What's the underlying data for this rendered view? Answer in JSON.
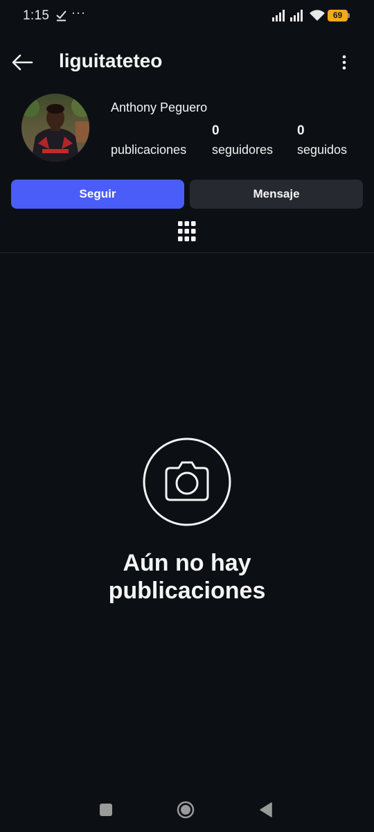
{
  "status_bar": {
    "time": "1:15",
    "dots": "···",
    "battery": "69",
    "icons": [
      "check-icon",
      "signal-icon",
      "signal-icon",
      "wifi-icon",
      "battery-icon"
    ]
  },
  "header": {
    "username": "liguitateteo",
    "back_icon": "arrow-left-icon",
    "more_icon": "more-vertical-icon"
  },
  "profile": {
    "full_name": "Anthony Peguero",
    "stats": [
      {
        "count": "",
        "label": "publicaciones"
      },
      {
        "count": "0",
        "label": "seguidores"
      },
      {
        "count": "0",
        "label": "seguidos"
      }
    ]
  },
  "actions": {
    "follow_label": "Seguir",
    "message_label": "Mensaje"
  },
  "tabs": {
    "grid_icon": "grid-icon"
  },
  "empty_state": {
    "icon": "camera-icon",
    "line1": "Aún no hay",
    "line2": "publicaciones"
  },
  "nav_bar": {
    "icons": [
      "recents-square-icon",
      "home-circle-icon",
      "back-triangle-icon"
    ]
  },
  "colors": {
    "background": "#0c1014",
    "primary": "#4a5df9",
    "secondary_button": "#262a30",
    "battery": "#f4a81d"
  }
}
